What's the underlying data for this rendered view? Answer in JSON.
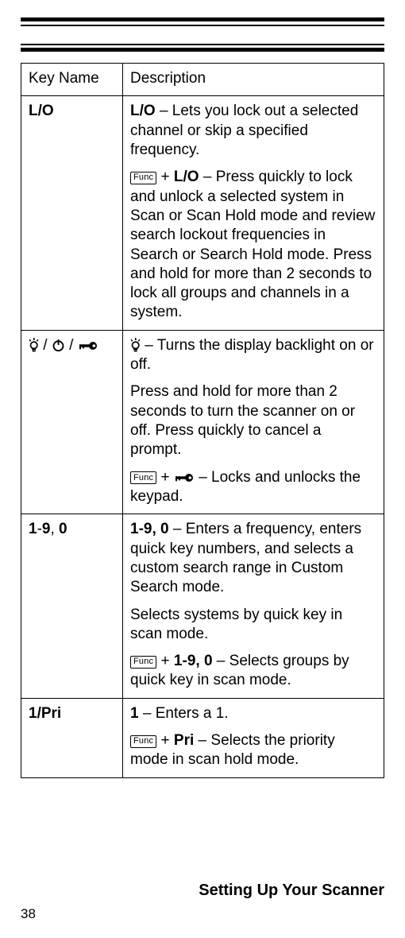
{
  "header": {
    "key_name": "Key Name",
    "description": "Description"
  },
  "rows": {
    "r0": {
      "key": "L/O",
      "p1a": "L/O",
      "p1b": " – Lets you lock out a selected channel or skip a specified frequency.",
      "func": "Func",
      "p2a": " + ",
      "p2b": "L/O",
      "p2c": " – Press quickly to lock and unlock a selected system in Scan or Scan Hold mode and review search lockout frequencies in Search or Search Hold mode. Press and hold for more than 2 seconds to lock all groups and channels in a system."
    },
    "r1": {
      "slash1": " / ",
      "slash2": " / ",
      "p1": " – Turns the display backlight on or off.",
      "p2": "Press and hold for more than 2 seconds to turn the scanner on or off. Press quickly to cancel a prompt.",
      "func": "Func",
      "p3a": " + ",
      "p3b": " – Locks and unlocks the keypad."
    },
    "r2": {
      "key_a": "1",
      "key_dash": "-",
      "key_b": "9",
      "key_comma": ", ",
      "key_c": "0",
      "p1a": "1-9, 0",
      "p1b": " – Enters a frequency, enters quick key numbers, and selects a custom search range in Custom Search mode.",
      "p2": "Selects systems by quick key in scan mode.",
      "func": "Func",
      "p3a": " + ",
      "p3b": "1-9, 0",
      "p3c": " – Selects groups by quick key in scan mode."
    },
    "r3": {
      "key": "1/Pri",
      "p1a": "1",
      "p1b": " – Enters a 1.",
      "func": "Func",
      "p2a": " + ",
      "p2b": "Pri",
      "p2c": " – Selects the priority mode in scan hold mode."
    }
  },
  "footer": {
    "section": "Setting Up Your Scanner",
    "page": "38"
  }
}
